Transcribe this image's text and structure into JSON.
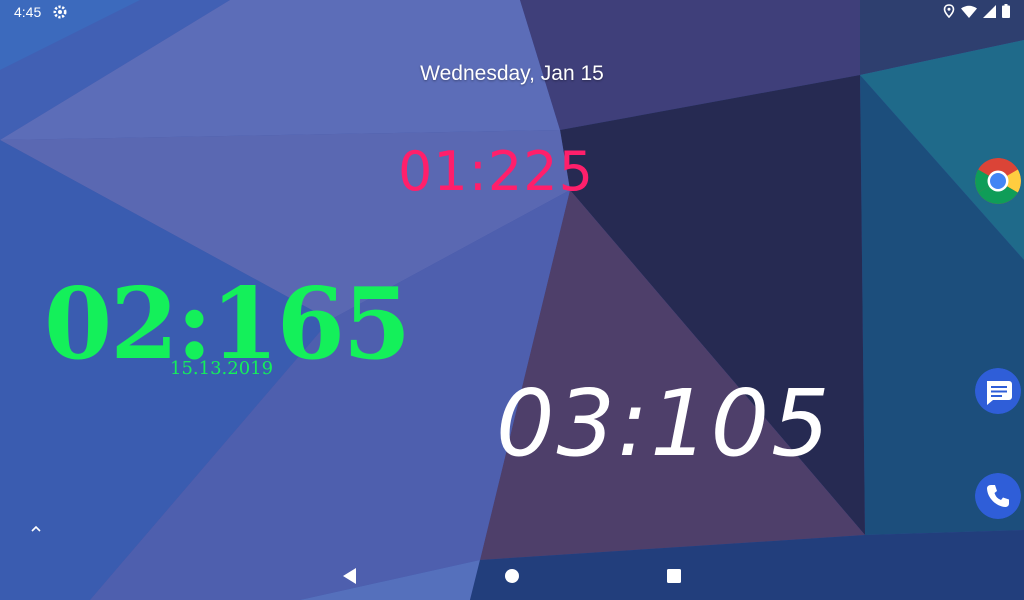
{
  "status_bar": {
    "time": "4:45",
    "icons": [
      "settings-icon",
      "location-icon",
      "wifi-icon",
      "signal-icon",
      "battery-icon"
    ]
  },
  "lock_screen": {
    "date": "Wednesday, Jan 15"
  },
  "widgets": {
    "clock_1": {
      "time": "01:225",
      "color": "#ff1f6b"
    },
    "clock_2": {
      "time": "02:165",
      "date": "15.13.2019",
      "color": "#14f05a"
    },
    "clock_3": {
      "time": "03:105",
      "color": "#ffffff"
    }
  },
  "dock": {
    "apps": [
      "chrome-icon",
      "messages-icon",
      "phone-icon"
    ]
  },
  "nav_bar": {
    "buttons": [
      "back-icon",
      "home-icon",
      "recents-icon"
    ]
  }
}
